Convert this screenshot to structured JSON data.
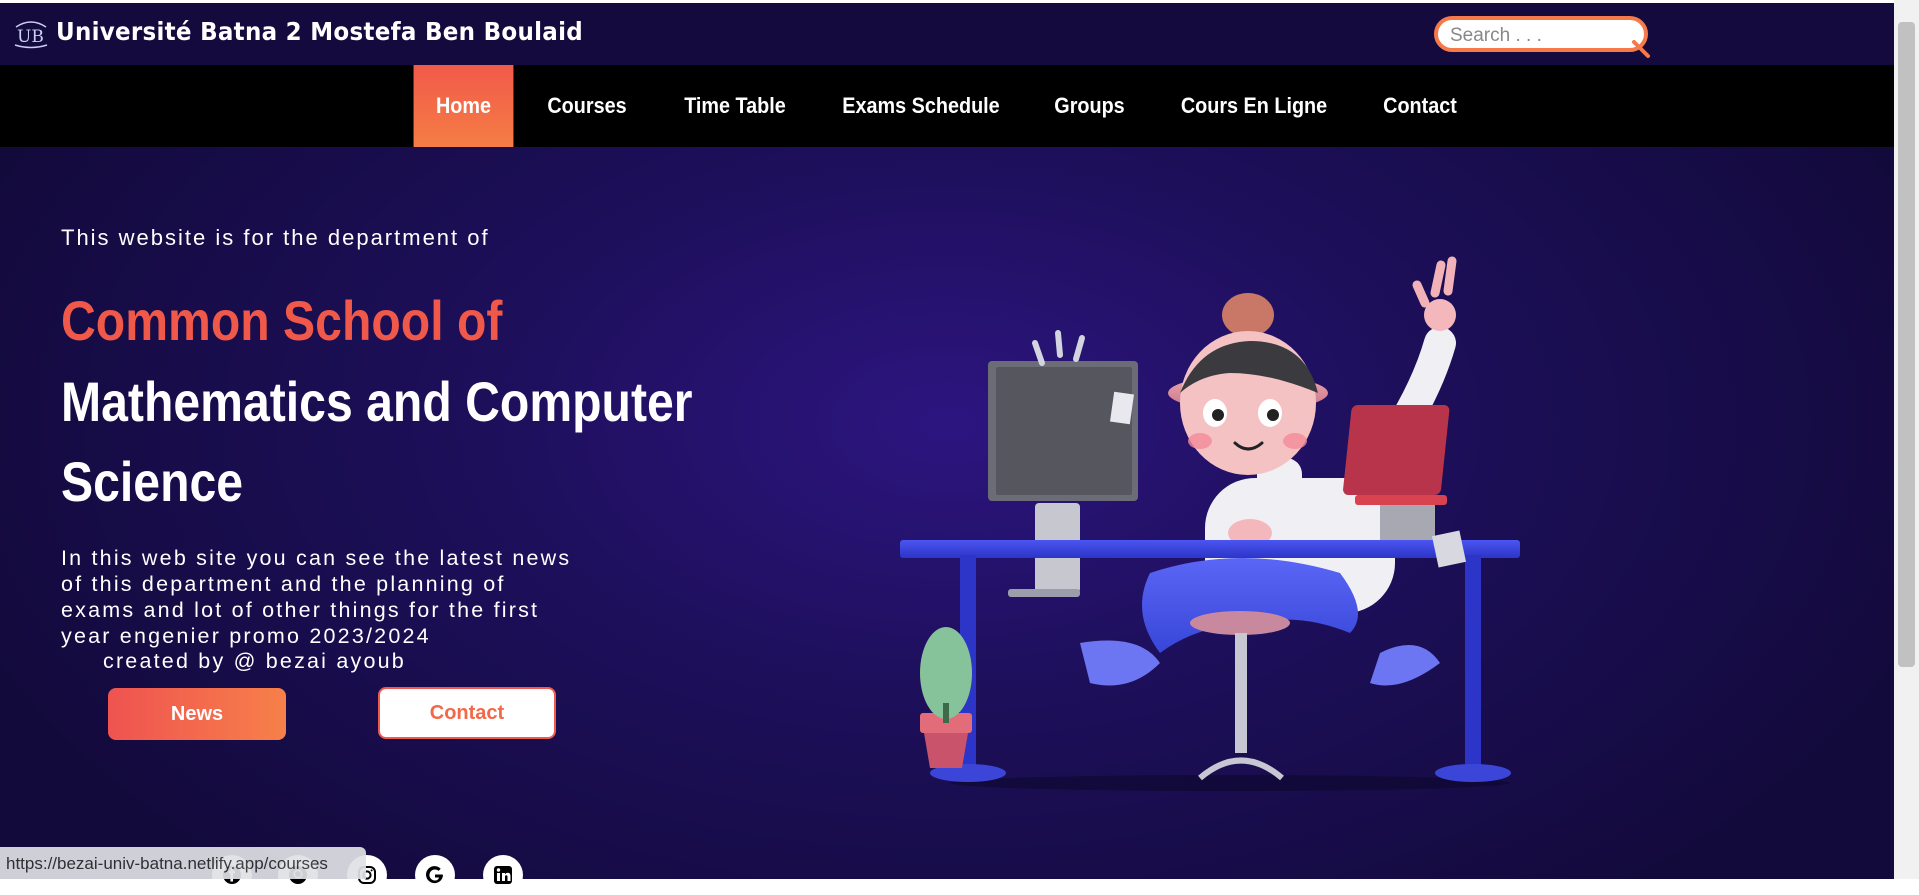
{
  "header": {
    "logo_icon": "university-logo-icon",
    "logo_text": "UB",
    "title": "Université Batna 2 Mostefa Ben Boulaid",
    "search_placeholder": "Search . . .",
    "search_icon": "magnifier-icon"
  },
  "nav": {
    "items": [
      {
        "label": "Home",
        "active": true
      },
      {
        "label": "Courses"
      },
      {
        "label": "Time Table"
      },
      {
        "label": "Exams Schedule"
      },
      {
        "label": "Groups"
      },
      {
        "label": "Cours En Ligne"
      },
      {
        "label": "Contact"
      }
    ],
    "active_gradient": [
      "#f15a4a",
      "#f57d45"
    ]
  },
  "hero": {
    "intro": "This website is for the department of",
    "headline_line1": "Common School of",
    "headline_line2": "Mathematics and Computer",
    "headline_line3": "Science",
    "description": "In this web site you can see the latest news of this department and the planning of exams and lot of other things for the first year engenier promo 2023/2024",
    "credit": "created by @ bezai ayoub",
    "news_button": "News",
    "contact_button": "Contact",
    "accent_color": "#f0584a"
  },
  "social": [
    {
      "icon": "facebook-icon"
    },
    {
      "icon": "github-icon"
    },
    {
      "icon": "instagram-icon"
    },
    {
      "icon": "google-icon"
    },
    {
      "icon": "linkedin-icon"
    }
  ],
  "status_bar": {
    "url": "https://bezai-univ-batna.netlify.app/courses"
  },
  "illustration": {
    "subject": "3d-character-at-desk-with-computer-and-laptop"
  }
}
